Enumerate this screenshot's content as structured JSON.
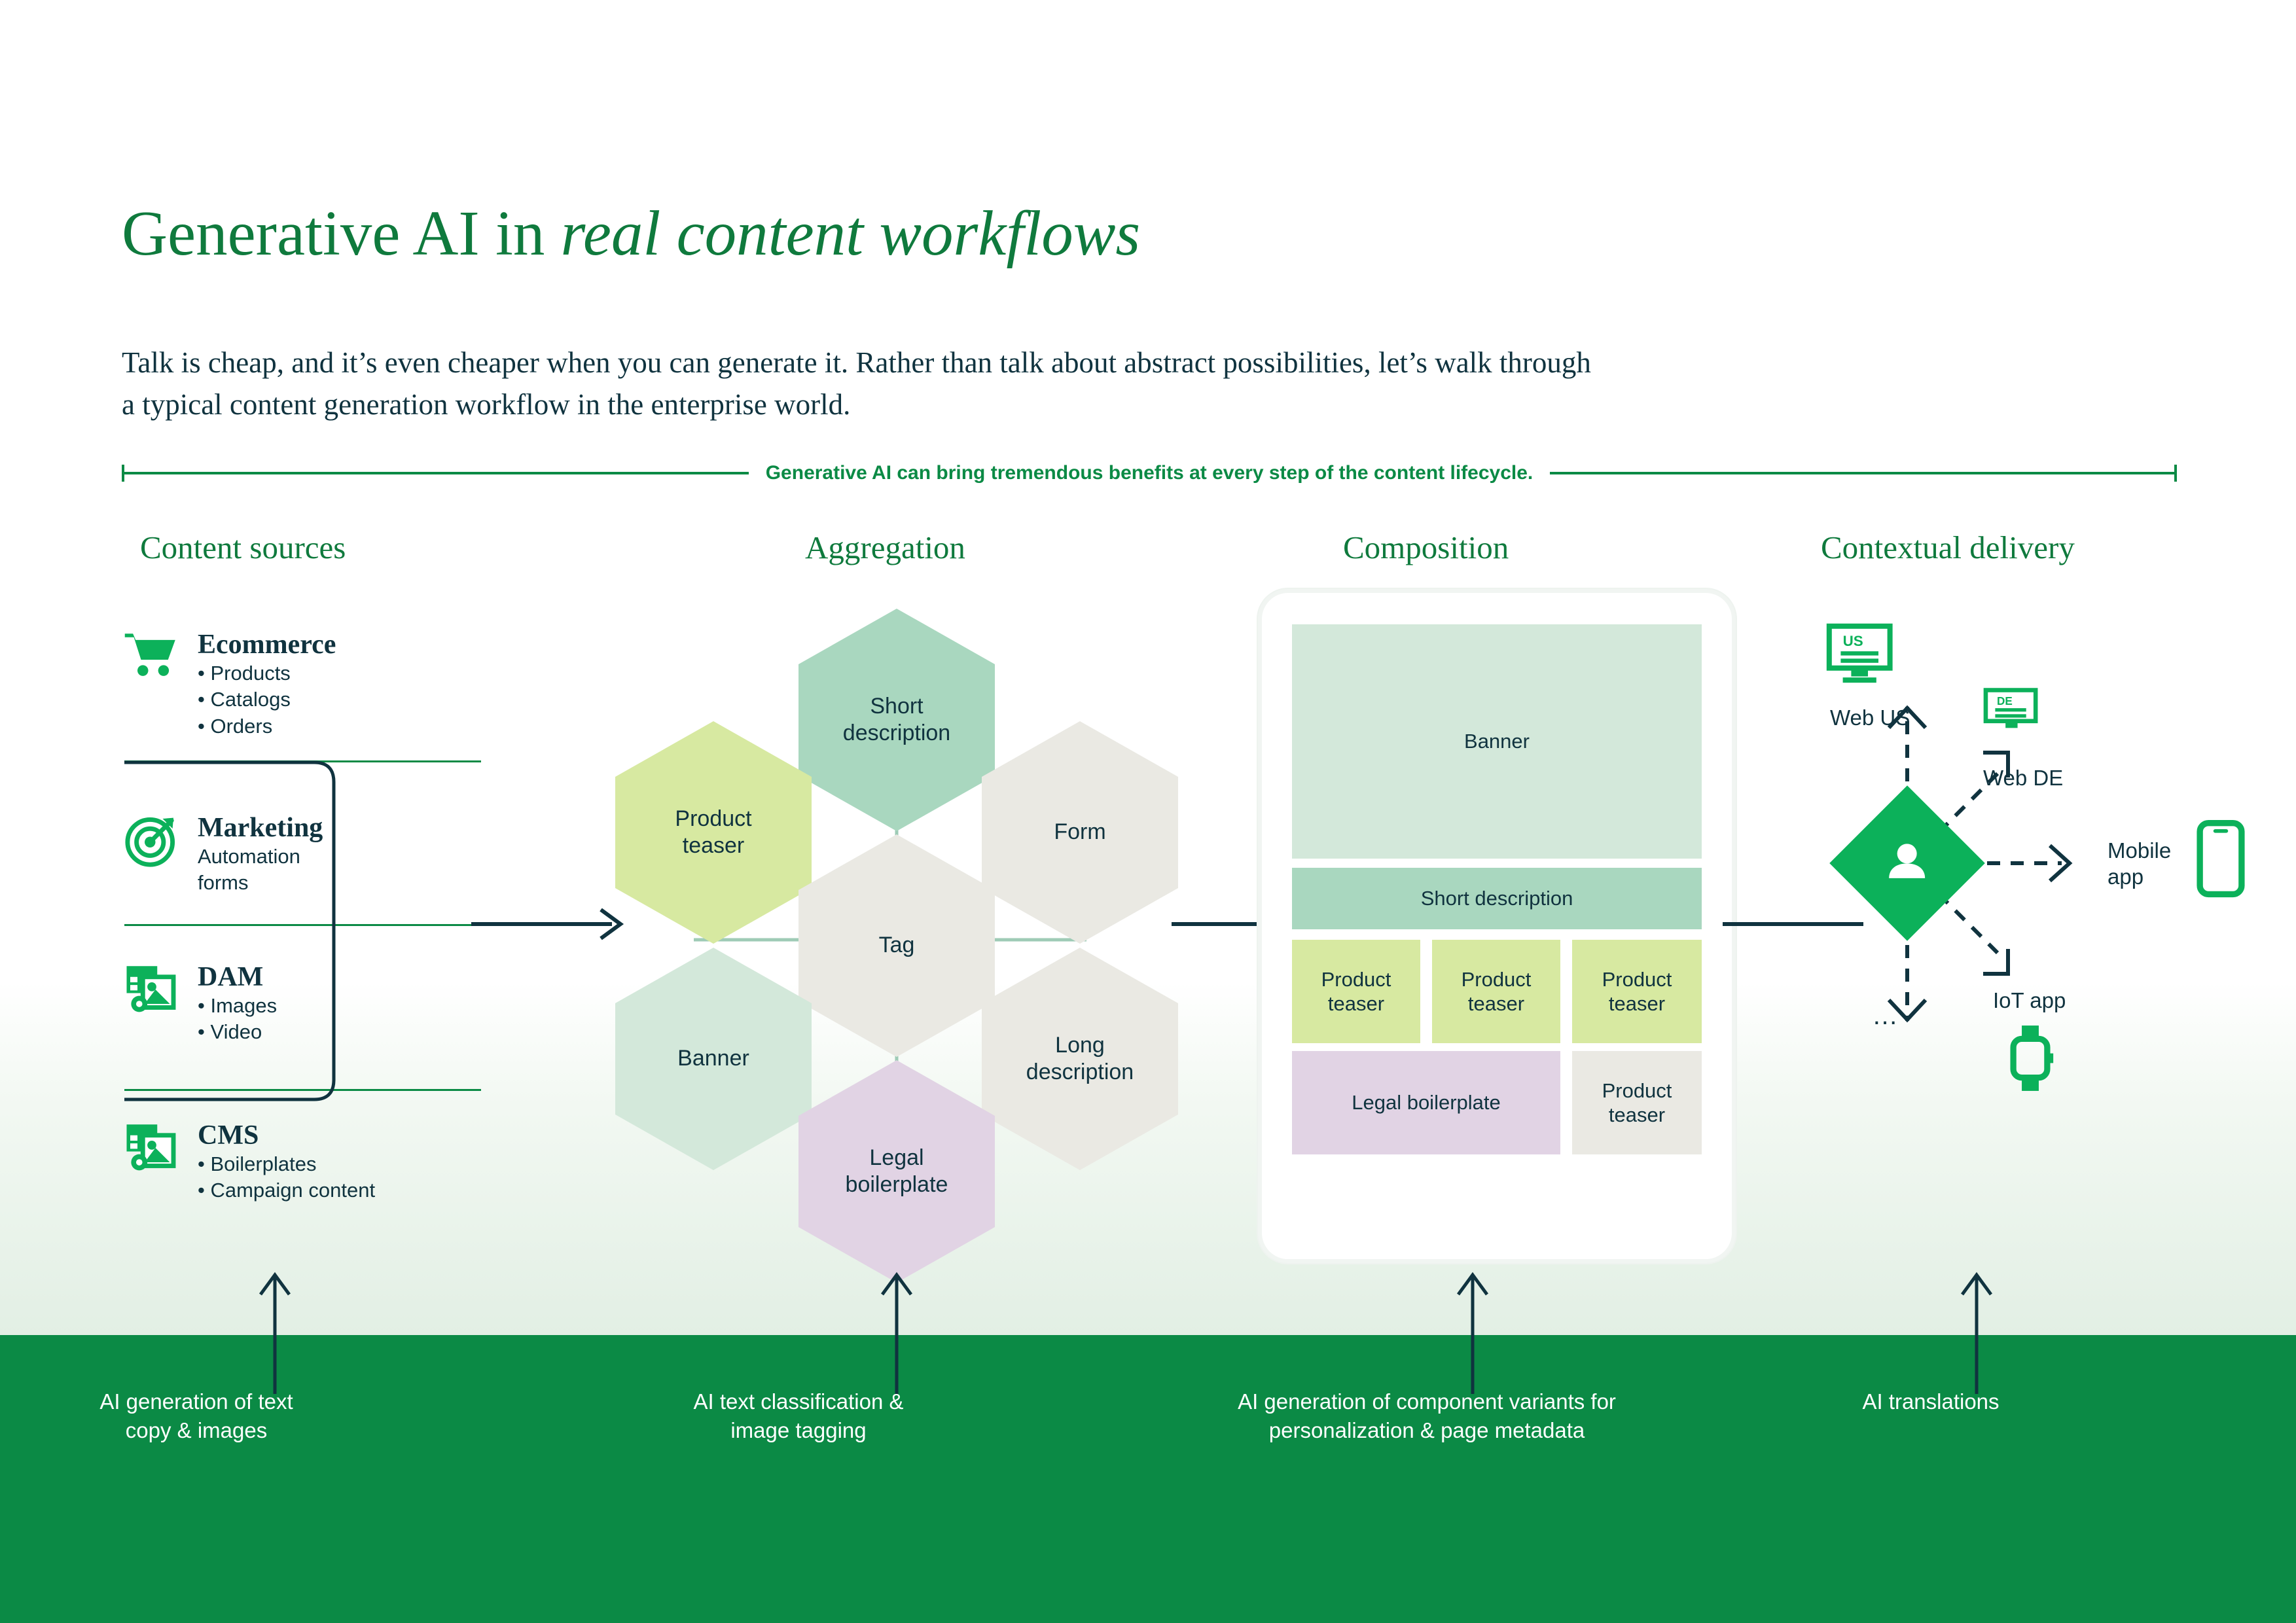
{
  "header": {
    "title_plain": "Generative AI in ",
    "title_italic": "real content workflows",
    "intro": "Talk is cheap, and it’s even cheaper when you can generate it. Rather than talk about abstract possibilities, let’s walk through a typical content generation workflow in the enterprise world."
  },
  "lifecycle_label": "Generative AI can bring tremendous benefits at every step of the content lifecycle.",
  "columns": {
    "sources": "Content sources",
    "aggregation": "Aggregation",
    "composition": "Composition",
    "contextual": "Contextual delivery"
  },
  "sources": [
    {
      "icon": "shopping-cart-icon",
      "name": "Ecommerce",
      "items": [
        "• Products",
        "• Catalogs",
        "• Orders"
      ]
    },
    {
      "icon": "target-icon",
      "name": "Marketing",
      "items": [
        "Automation",
        "forms"
      ]
    },
    {
      "icon": "media-assets-icon",
      "name": "DAM",
      "items": [
        "• Images",
        "• Video"
      ]
    },
    {
      "icon": "media-assets-icon",
      "name": "CMS",
      "items": [
        "• Boilerplates",
        "• Campaign content"
      ]
    }
  ],
  "aggregation_hexes": [
    {
      "id": "short",
      "label": "Short\ndescription",
      "color": "#a9d7bf"
    },
    {
      "id": "product",
      "label": "Product\nteaser",
      "color": "#d7e9a1"
    },
    {
      "id": "form",
      "label": "Form",
      "color": "#eae9e3"
    },
    {
      "id": "tag",
      "label": "Tag",
      "color": "#eae9e3"
    },
    {
      "id": "banner",
      "label": "Banner",
      "color": "#d3e8da"
    },
    {
      "id": "long",
      "label": "Long\ndescription",
      "color": "#eae9e3"
    },
    {
      "id": "legal",
      "label": "Legal\nboilerplate",
      "color": "#e1d3e4"
    }
  ],
  "composition_tiles": [
    {
      "id": "banner",
      "label": "Banner",
      "color": "#d3e8da"
    },
    {
      "id": "short",
      "label": "Short description",
      "color": "#a9d7bf"
    },
    {
      "id": "teaser1",
      "label": "Product\nteaser",
      "color": "#d7e9a1"
    },
    {
      "id": "teaser2",
      "label": "Product\nteaser",
      "color": "#d7e9a1"
    },
    {
      "id": "teaser3",
      "label": "Product\nteaser",
      "color": "#d7e9a1"
    },
    {
      "id": "legal",
      "label": "Legal boilerplate",
      "color": "#e1d3e4"
    },
    {
      "id": "teaser4",
      "label": "Product\nteaser",
      "color": "#eae9e3"
    }
  ],
  "contextual": {
    "hub_icon": "user-persona-icon",
    "channels": [
      {
        "id": "web-us",
        "label": "Web US",
        "icon": "monitor-us-icon",
        "badge": "US"
      },
      {
        "id": "web-de",
        "label": "Web DE",
        "icon": "monitor-de-icon",
        "badge": "DE"
      },
      {
        "id": "mobile-app",
        "label": "Mobile\napp",
        "icon": "smartphone-icon",
        "badge": ""
      },
      {
        "id": "iot-app",
        "label": "IoT app",
        "icon": "smartwatch-icon",
        "badge": ""
      },
      {
        "id": "more",
        "label": "…",
        "icon": "ellipsis-icon",
        "badge": ""
      }
    ]
  },
  "ai_captions": [
    "AI generation of text\ncopy & images",
    "AI text classification &\nimage tagging",
    "AI generation of component variants for\npersonalization & page metadata",
    "AI translations"
  ],
  "colors": {
    "brand_green": "#0b8a45",
    "bright_green": "#0cb15a",
    "heading_green": "#0f7a3d",
    "ink": "#10333f",
    "banner_bg": "#0b8a45"
  }
}
